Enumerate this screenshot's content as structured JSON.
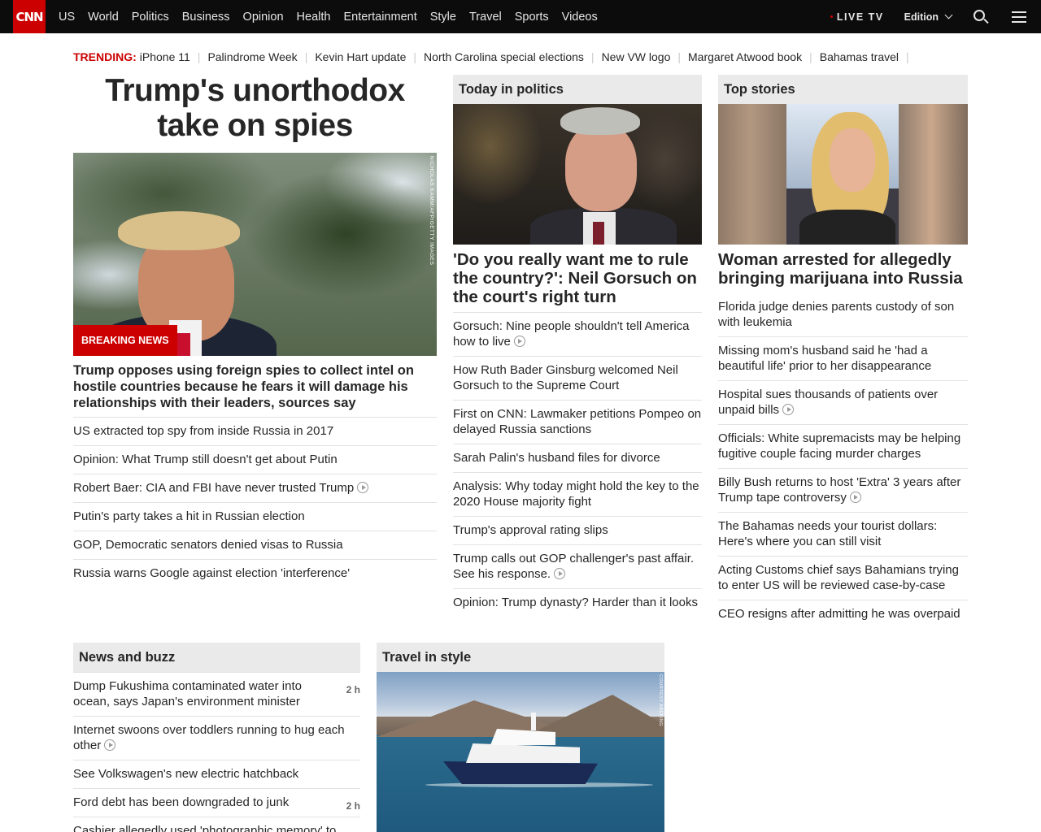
{
  "nav": {
    "logo": "CNN",
    "links": [
      "US",
      "World",
      "Politics",
      "Business",
      "Opinion",
      "Health",
      "Entertainment",
      "Style",
      "Travel",
      "Sports",
      "Videos"
    ],
    "live_tv": "LIVE TV",
    "edition": "Edition"
  },
  "trending": {
    "label": "TRENDING:",
    "items": [
      "iPhone 11",
      "Palindrome Week",
      "Kevin Hart update",
      "North Carolina special elections",
      "New VW logo",
      "Margaret Atwood book",
      "Bahamas travel"
    ]
  },
  "main": {
    "headline": "Trump's unorthodox take on spies",
    "image_credit": "NICHOLAS KAMM/AFP/GETTY IMAGES",
    "badge": "BREAKING NEWS",
    "lead": "Trump opposes using foreign spies to collect intel on hostile countries because he fears it will damage his relationships with their leaders, sources say",
    "links": [
      {
        "text": "US extracted top spy from inside Russia in 2017",
        "video": false
      },
      {
        "text": "Opinion: What Trump still doesn't get about Putin",
        "video": false
      },
      {
        "text": "Robert Baer: CIA and FBI have never trusted Trump",
        "video": true
      },
      {
        "text": "Putin's party takes a hit in Russian election",
        "video": false
      },
      {
        "text": "GOP, Democratic senators denied visas to Russia",
        "video": false
      },
      {
        "text": "Russia warns Google against election 'interference'",
        "video": false
      }
    ]
  },
  "politics": {
    "title": "Today in politics",
    "headline": "'Do you really want me to rule the country?': Neil Gorsuch on the court's right turn",
    "links": [
      {
        "text": "Gorsuch: Nine people shouldn't tell America how to live",
        "video": true
      },
      {
        "text": "How Ruth Bader Ginsburg welcomed Neil Gorsuch to the Supreme Court",
        "video": false
      },
      {
        "text": "First on CNN: Lawmaker petitions Pompeo on delayed Russia sanctions",
        "video": false
      },
      {
        "text": "Sarah Palin's husband files for divorce",
        "video": false
      },
      {
        "text": "Analysis: Why today might hold the key to the 2020 House majority fight",
        "video": false
      },
      {
        "text": "Trump's approval rating slips",
        "video": false
      },
      {
        "text": "Trump calls out GOP challenger's past affair. See his response.",
        "video": true
      },
      {
        "text": "Opinion: Trump dynasty? Harder than it looks",
        "video": false
      }
    ]
  },
  "top_stories": {
    "title": "Top stories",
    "headline": "Woman arrested for allegedly bringing marijuana into Russia",
    "links": [
      {
        "text": "Florida judge denies parents custody of son with leukemia",
        "video": false
      },
      {
        "text": "Missing mom's husband said he 'had a beautiful life' prior to her disappearance",
        "video": false
      },
      {
        "text": "Hospital sues thousands of patients over unpaid bills",
        "video": true
      },
      {
        "text": "Officials: White supremacists may be helping fugitive couple facing murder charges",
        "video": false
      },
      {
        "text": "Billy Bush returns to host 'Extra' 3 years after Trump tape controversy",
        "video": true
      },
      {
        "text": "The Bahamas needs your tourist dollars: Here's where you can still visit",
        "video": false
      },
      {
        "text": "Acting Customs chief says Bahamians trying to enter US will be reviewed case-by-case",
        "video": false
      },
      {
        "text": "CEO resigns after admitting he was overpaid",
        "video": false
      }
    ]
  },
  "news_buzz": {
    "title": "News and buzz",
    "links": [
      {
        "text": "Dump Fukushima contaminated water into ocean, says Japan's environment minister",
        "time": "2 h",
        "video": false
      },
      {
        "text": "Internet swoons over toddlers running to hug each other",
        "time": "",
        "video": true
      },
      {
        "text": "See Volkswagen's new electric hatchback",
        "time": "",
        "video": false
      },
      {
        "text": "Ford debt has been downgraded to junk",
        "time": "2 h",
        "video": false
      },
      {
        "text": "Cashier allegedly used 'photographic memory' to",
        "time": "",
        "video": false
      }
    ]
  },
  "travel": {
    "title": "Travel in style",
    "image_credit": "COURTESY ABEKING"
  }
}
